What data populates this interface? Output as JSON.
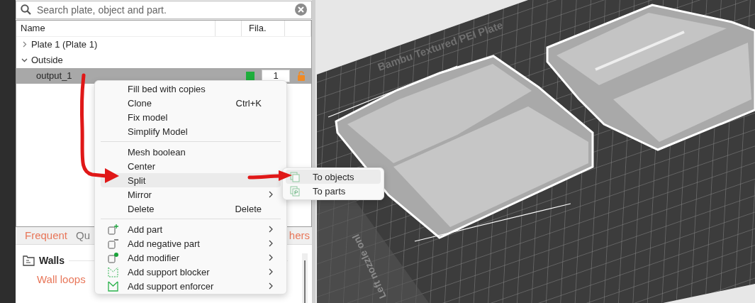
{
  "search": {
    "placeholder": "Search plate, object and part."
  },
  "object_list": {
    "columns": [
      "Name",
      "Fila."
    ],
    "items": [
      {
        "name": "Plate 1 (Plate 1)",
        "expanded": false,
        "selected": false
      },
      {
        "name": "Outside",
        "expanded": true,
        "selected": false,
        "children": [
          {
            "name": "output_1",
            "selected": true,
            "color": "#1fae3c",
            "filament": "1"
          }
        ]
      }
    ]
  },
  "context_menu": {
    "groups": [
      {
        "items": [
          {
            "label": "Fill bed with copies",
            "kind": "plain",
            "highlighted": false,
            "submenu": false
          },
          {
            "label": "Clone",
            "shortcut": "Ctrl+K",
            "kind": "plain",
            "highlighted": false,
            "submenu": false
          },
          {
            "label": "Fix model",
            "kind": "plain",
            "highlighted": false,
            "submenu": false
          },
          {
            "label": "Simplify Model",
            "kind": "plain",
            "highlighted": false,
            "submenu": false
          }
        ]
      },
      {
        "items": [
          {
            "label": "Mesh boolean",
            "kind": "plain",
            "highlighted": false,
            "submenu": false
          },
          {
            "label": "Center",
            "kind": "plain",
            "highlighted": false,
            "submenu": false
          },
          {
            "label": "Split",
            "kind": "plain",
            "highlighted": true,
            "submenu": false
          },
          {
            "label": "Mirror",
            "kind": "plain",
            "highlighted": false,
            "submenu": true
          },
          {
            "label": "Delete",
            "shortcut": "Delete",
            "kind": "plain",
            "highlighted": false,
            "submenu": false
          }
        ]
      },
      {
        "items": [
          {
            "label": "Add part",
            "kind": "add-part",
            "highlighted": false,
            "submenu": true
          },
          {
            "label": "Add negative part",
            "kind": "add-negative",
            "highlighted": false,
            "submenu": true
          },
          {
            "label": "Add modifier",
            "kind": "add-modifier",
            "highlighted": false,
            "submenu": true
          },
          {
            "label": "Add support blocker",
            "kind": "support-blocker",
            "highlighted": false,
            "submenu": true
          },
          {
            "label": "Add support enforcer",
            "kind": "support-enforcer",
            "highlighted": false,
            "submenu": true
          }
        ]
      }
    ]
  },
  "submenu": {
    "items": [
      {
        "label": "To objects",
        "kind": "objects",
        "selected": true
      },
      {
        "label": "To parts",
        "kind": "parts",
        "selected": false
      }
    ]
  },
  "settings_tabs": [
    {
      "label": "Frequent",
      "modified": true
    },
    {
      "label": "Qu",
      "modified": false
    },
    {
      "label": "hers",
      "modified": true
    }
  ],
  "section": {
    "title": "Walls",
    "settings": [
      {
        "label": "Wall loops",
        "modified": true
      }
    ]
  },
  "viewport": {
    "plate_labels": [
      "Bambu Textured PEI Plate",
      "Left nozzle onl"
    ]
  }
}
